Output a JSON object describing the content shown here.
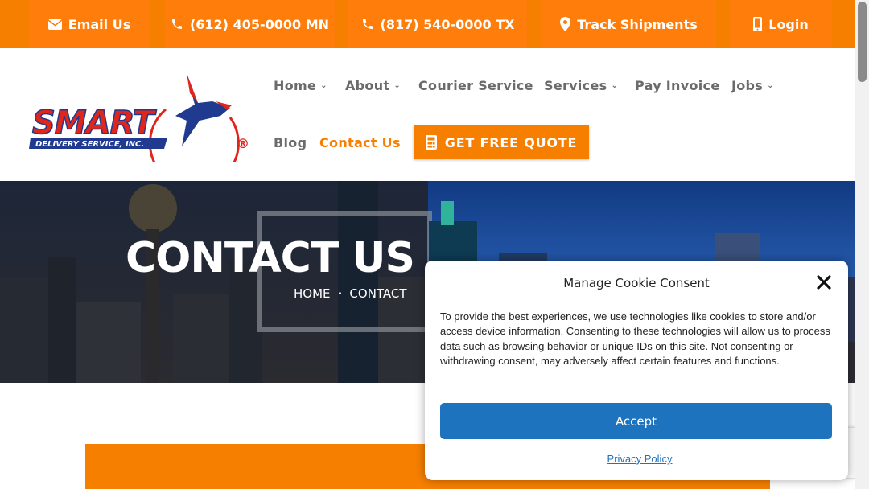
{
  "colors": {
    "brand_orange": "#f77f00",
    "accent_blue": "#1e73be",
    "nav_gray": "#6b6b6b"
  },
  "topbar": {
    "items": [
      {
        "label": "Email Us",
        "icon": "envelope-icon"
      },
      {
        "label": "(612) 405-0000 MN",
        "icon": "phone-icon"
      },
      {
        "label": "(817) 540-0000 TX",
        "icon": "phone-icon"
      },
      {
        "label": "Track Shipments",
        "icon": "map-marker-icon"
      },
      {
        "label": "Login",
        "icon": "mobile-icon"
      }
    ]
  },
  "logo": {
    "name": "SMART",
    "tagline": "DELIVERY SERVICE, INC.",
    "registered": "®"
  },
  "nav": {
    "items": [
      {
        "label": "Home",
        "dropdown": true
      },
      {
        "label": "About",
        "dropdown": true
      },
      {
        "label": "Courier Service",
        "dropdown": false
      },
      {
        "label": "Services",
        "dropdown": true
      },
      {
        "label": "Pay Invoice",
        "dropdown": false
      },
      {
        "label": "Jobs",
        "dropdown": true
      },
      {
        "label": "Blog",
        "dropdown": false
      },
      {
        "label": "Contact Us",
        "dropdown": false,
        "active": true
      }
    ],
    "quote_label": "GET FREE QUOTE"
  },
  "hero": {
    "title": "CONTACT US",
    "breadcrumb": [
      "HOME",
      "CONTACT"
    ],
    "separator": "•"
  },
  "cookie": {
    "title": "Manage Cookie Consent",
    "body": "To provide the best experiences, we use technologies like cookies to store and/or access device information. Consenting to these technologies will allow us to process data such as browsing behavior or unique IDs on this site. Not consenting or withdrawing consent, may adversely affect certain features and functions.",
    "accept_label": "Accept",
    "privacy_label": "Privacy Policy"
  }
}
